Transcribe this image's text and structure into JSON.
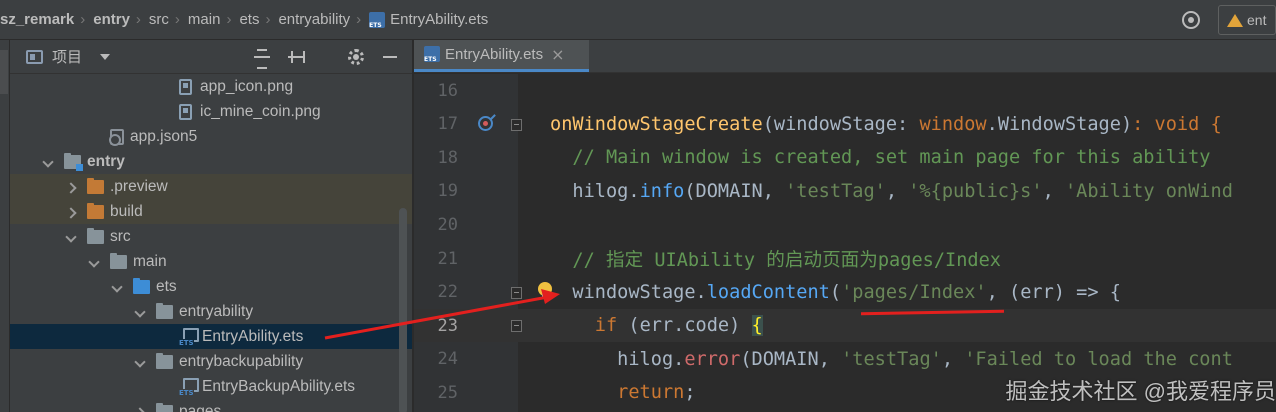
{
  "breadcrumb": {
    "items": [
      "sz_remark",
      "entry",
      "src",
      "main",
      "ets",
      "entryability",
      "EntryAbility.ets"
    ],
    "bold_count": 2
  },
  "run_config": {
    "label": "ent"
  },
  "project_panel": {
    "title": "项目",
    "tree": [
      {
        "label": "app_icon.png",
        "icon": "image-icon",
        "indent": 6,
        "chevron": "none"
      },
      {
        "label": "ic_mine_coin.png",
        "icon": "image-icon",
        "indent": 6,
        "chevron": "none"
      },
      {
        "label": "app.json5",
        "icon": "json-icon",
        "indent": 3,
        "chevron": "none"
      },
      {
        "label": "entry",
        "icon": "module-folder-icon",
        "indent": 1,
        "chevron": "down",
        "bold": true
      },
      {
        "label": ".preview",
        "icon": "orange-folder-icon",
        "indent": 2,
        "chevron": "right",
        "highlight": "olive"
      },
      {
        "label": "build",
        "icon": "orange-folder-icon",
        "indent": 2,
        "chevron": "right",
        "highlight": "olive"
      },
      {
        "label": "src",
        "icon": "folder-icon",
        "indent": 2,
        "chevron": "down"
      },
      {
        "label": "main",
        "icon": "folder-icon",
        "indent": 3,
        "chevron": "down"
      },
      {
        "label": "ets",
        "icon": "blue-folder-icon",
        "indent": 4,
        "chevron": "down"
      },
      {
        "label": "entryability",
        "icon": "folder-icon",
        "indent": 5,
        "chevron": "down"
      },
      {
        "label": "EntryAbility.ets",
        "icon": "ets-file-icon",
        "indent": 6,
        "chevron": "none",
        "selected": true
      },
      {
        "label": "entrybackupability",
        "icon": "folder-icon",
        "indent": 5,
        "chevron": "down"
      },
      {
        "label": "EntryBackupAbility.ets",
        "icon": "ets-file-icon",
        "indent": 6,
        "chevron": "none"
      },
      {
        "label": "pages",
        "icon": "folder-icon",
        "indent": 5,
        "chevron": "right"
      }
    ]
  },
  "editor": {
    "tab": {
      "label": "EntryAbility.ets",
      "close": "×"
    },
    "line_numbers": [
      "16",
      "17",
      "18",
      "19",
      "20",
      "21",
      "22",
      "23",
      "24",
      "25"
    ],
    "current_line": "23",
    "lines": [
      [],
      [
        [
          "fn",
          "onWindowStageCreate"
        ],
        [
          "id",
          "(windowStage: "
        ],
        [
          "type",
          "window"
        ],
        [
          "id",
          "."
        ],
        [
          "id",
          "WindowStage"
        ],
        [
          "id",
          ")"
        ],
        [
          "kw",
          ": void {"
        ]
      ],
      [
        [
          "cm",
          "  // Main window is created, set main page for this ability"
        ]
      ],
      [
        [
          "id",
          "  hilog."
        ],
        [
          "method",
          "info"
        ],
        [
          "id",
          "(DOMAIN, "
        ],
        [
          "str",
          "'testTag'"
        ],
        [
          "id",
          ", "
        ],
        [
          "str",
          "'%{public}s'"
        ],
        [
          "id",
          ", "
        ],
        [
          "str",
          "'Ability onWind"
        ]
      ],
      [],
      [
        [
          "cm",
          "  // 指定 UIAbility 的启动页面为pages/Index"
        ]
      ],
      [
        [
          "id",
          "  windowStage."
        ],
        [
          "method",
          "loadContent"
        ],
        [
          "id",
          "("
        ],
        [
          "str",
          "'pages/Index'"
        ],
        [
          "id",
          ", (err) => {"
        ]
      ],
      [
        [
          "kw",
          "    if "
        ],
        [
          "id",
          "(err.code) "
        ],
        [
          "brace",
          "{"
        ]
      ],
      [
        [
          "id",
          "      hilog."
        ],
        [
          "err",
          "error"
        ],
        [
          "id",
          "(DOMAIN, "
        ],
        [
          "str",
          "'testTag'"
        ],
        [
          "id",
          ", "
        ],
        [
          "str",
          "'Failed to load the cont"
        ]
      ],
      [
        [
          "kw",
          "      return"
        ],
        [
          "id",
          ";"
        ]
      ]
    ]
  },
  "watermark": "掘金技术社区 @我爱程序员"
}
